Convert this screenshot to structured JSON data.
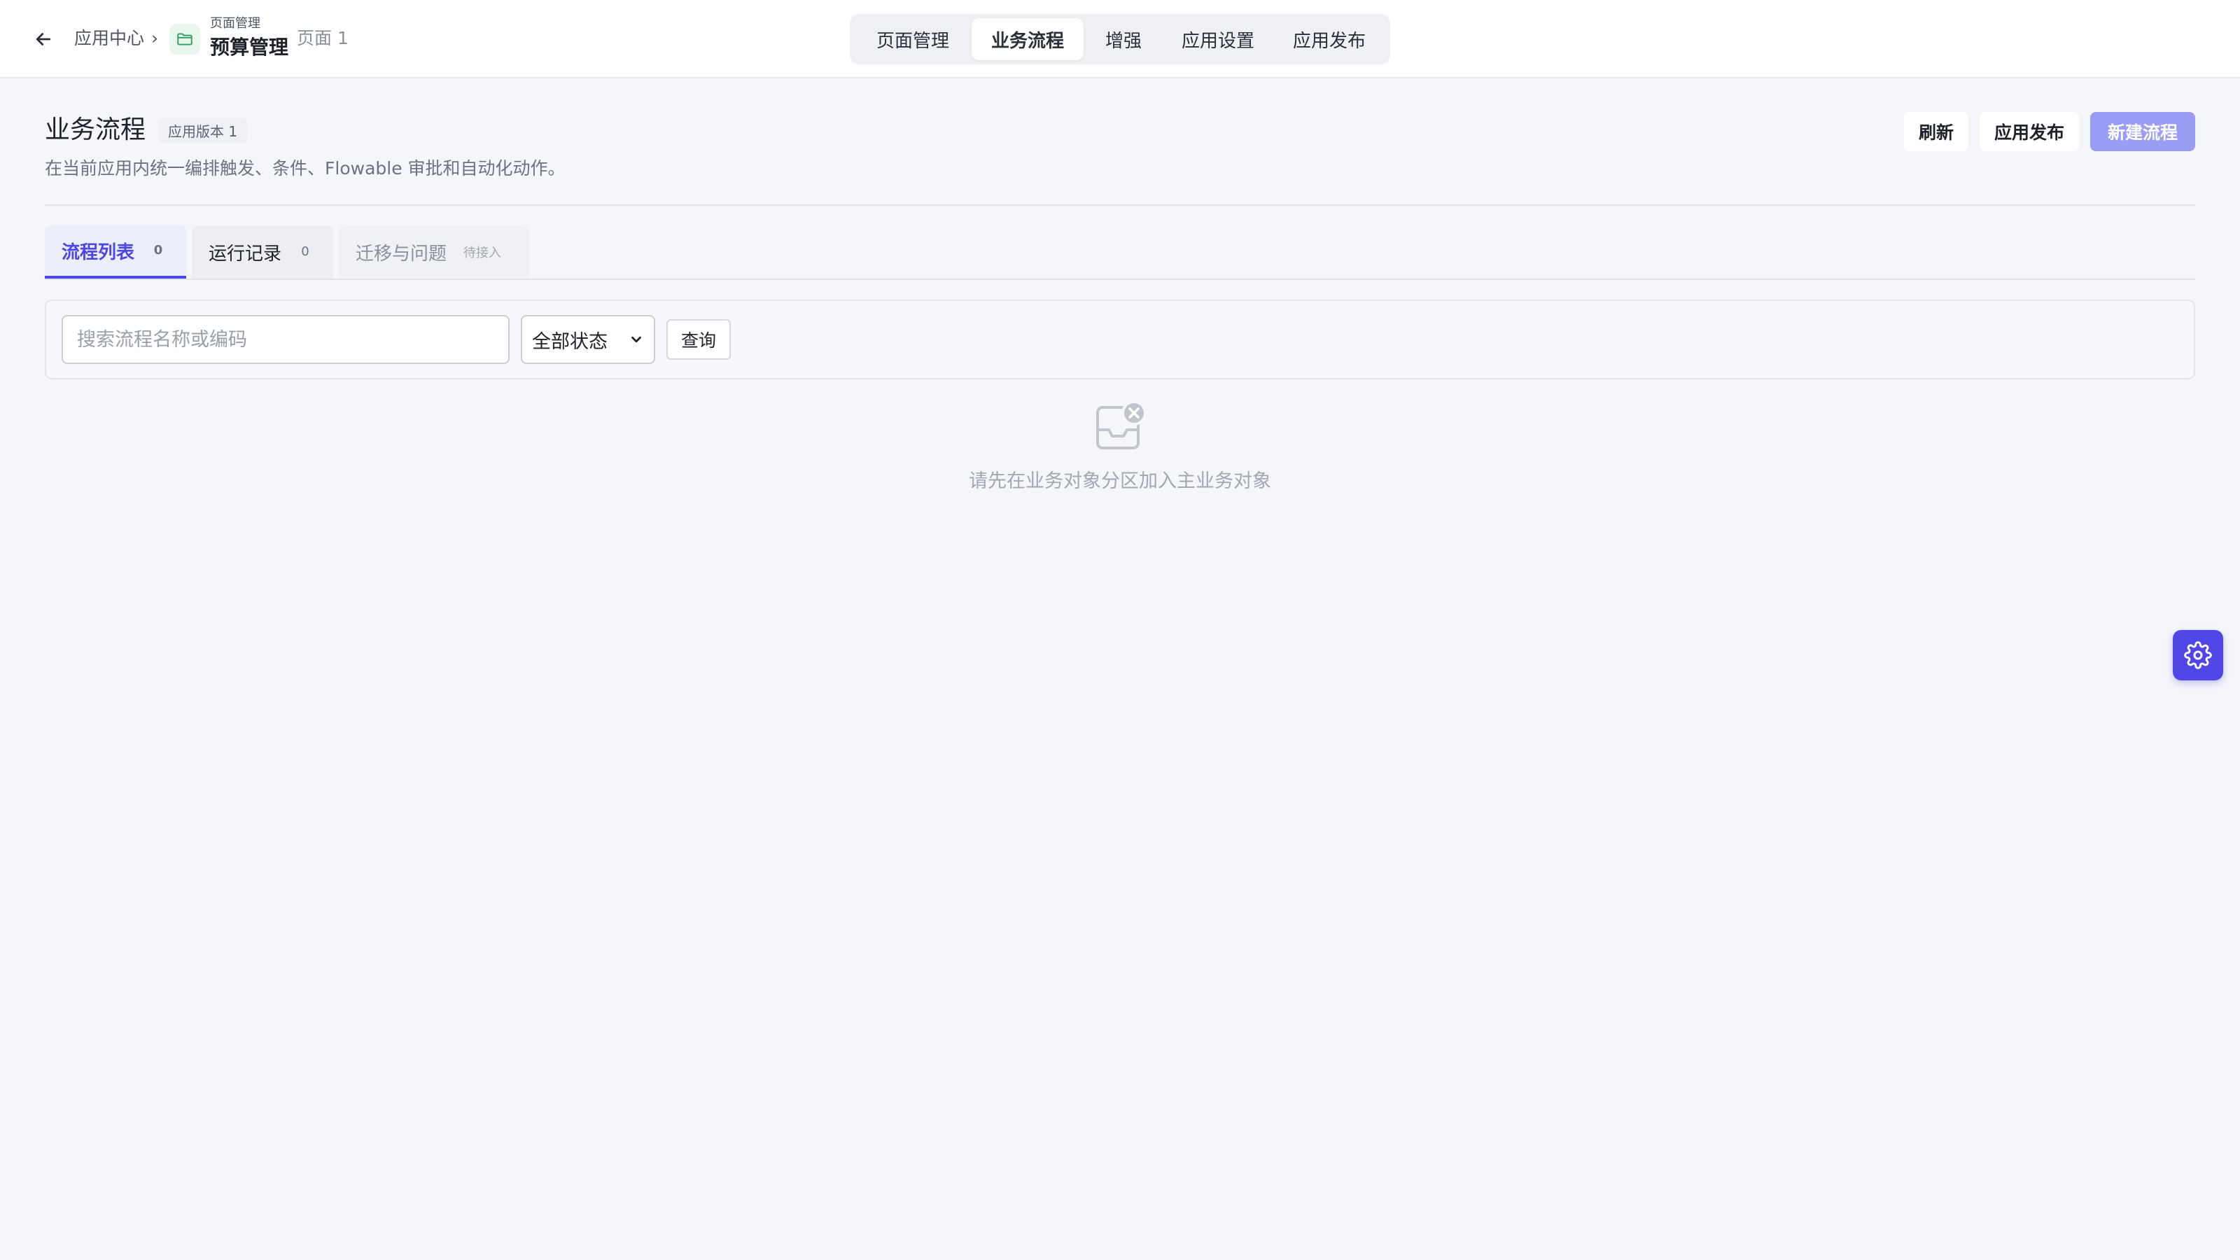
{
  "header": {
    "breadcrumb_root": "应用中心",
    "breadcrumb_sep": "›",
    "app_group": "页面管理",
    "app_name": "预算管理",
    "page_name": "页面 1",
    "back_icon": "arrow-left-icon",
    "app_icon": "folder-icon",
    "app_icon_color": "#2f9e5b"
  },
  "nav": {
    "tabs": [
      {
        "label": "页面管理"
      },
      {
        "label": "业务流程",
        "active": true
      },
      {
        "label": "增强"
      },
      {
        "label": "应用设置"
      },
      {
        "label": "应用发布"
      }
    ]
  },
  "page": {
    "title": "业务流程",
    "version_badge": "应用版本 1",
    "description": "在当前应用内统一编排触发、条件、Flowable 审批和自动化动作。"
  },
  "actions": {
    "refresh": "刷新",
    "publish": "应用发布",
    "new_flow": "新建流程",
    "primary_color": "#9b9cf3"
  },
  "subtabs": [
    {
      "label": "流程列表",
      "count": "0",
      "active": true
    },
    {
      "label": "运行记录",
      "count": "0"
    },
    {
      "label": "迁移与问题",
      "tag": "待接入"
    }
  ],
  "filter": {
    "search_placeholder": "搜索流程名称或编码",
    "search_value": "",
    "status_selected": "全部状态",
    "query_label": "查询"
  },
  "empty": {
    "icon": "empty-inbox-icon",
    "message": "请先在业务对象分区加入主业务对象"
  },
  "float": {
    "icon": "gear-icon",
    "color": "#4f46e5"
  }
}
